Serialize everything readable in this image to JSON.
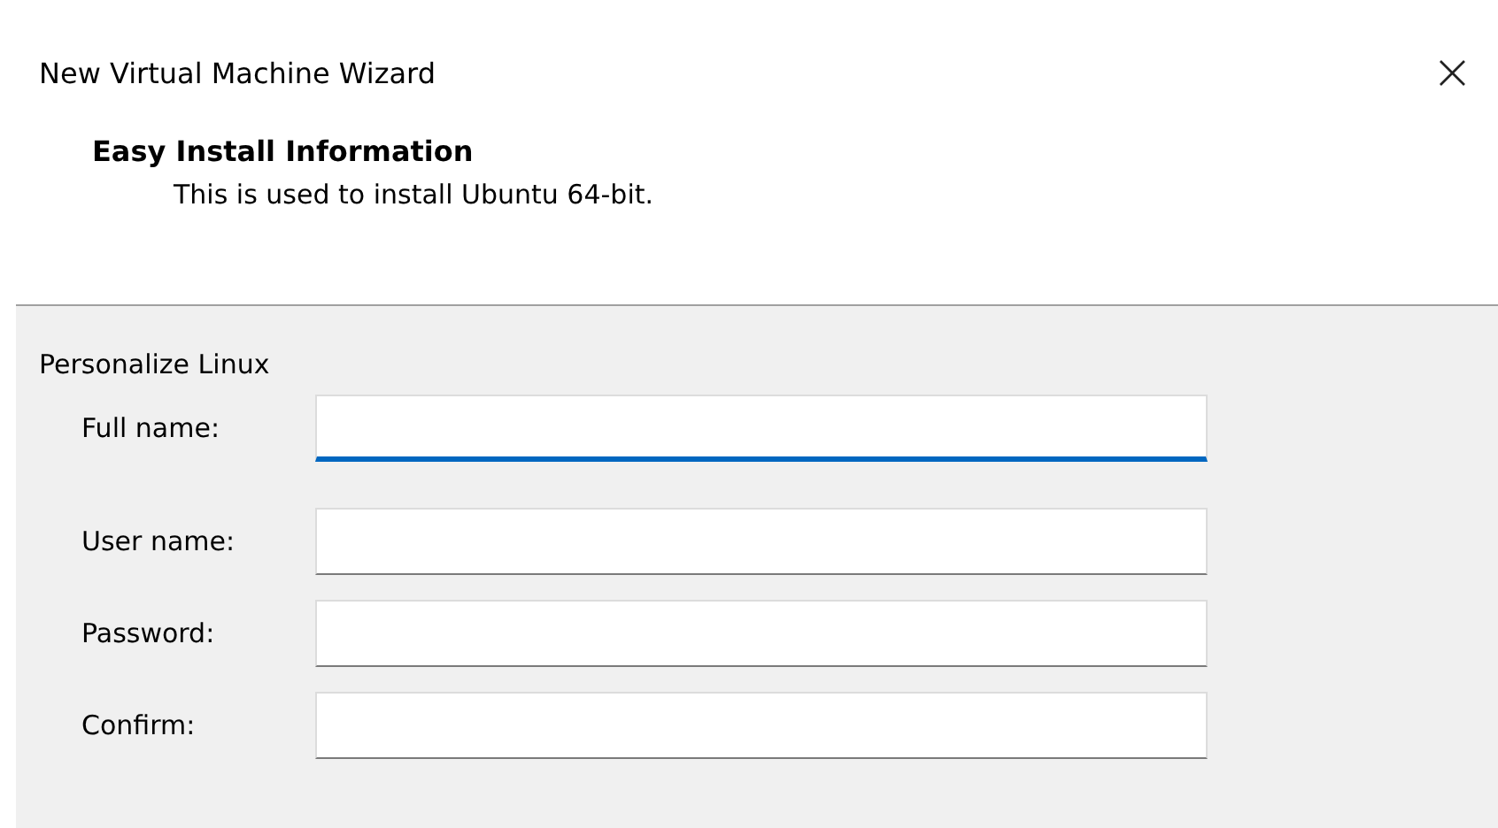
{
  "window": {
    "title": "New Virtual Machine Wizard",
    "close": "×"
  },
  "header": {
    "title": "Easy Install Information",
    "subtitle": "This is used to install Ubuntu 64-bit."
  },
  "section": {
    "title": "Personalize Linux",
    "fields": [
      {
        "label": "Full name:",
        "focused": true
      },
      {
        "label": "User name:",
        "focused": false
      },
      {
        "label": "Password:",
        "focused": false
      },
      {
        "label": "Confirm:",
        "focused": false
      }
    ]
  }
}
